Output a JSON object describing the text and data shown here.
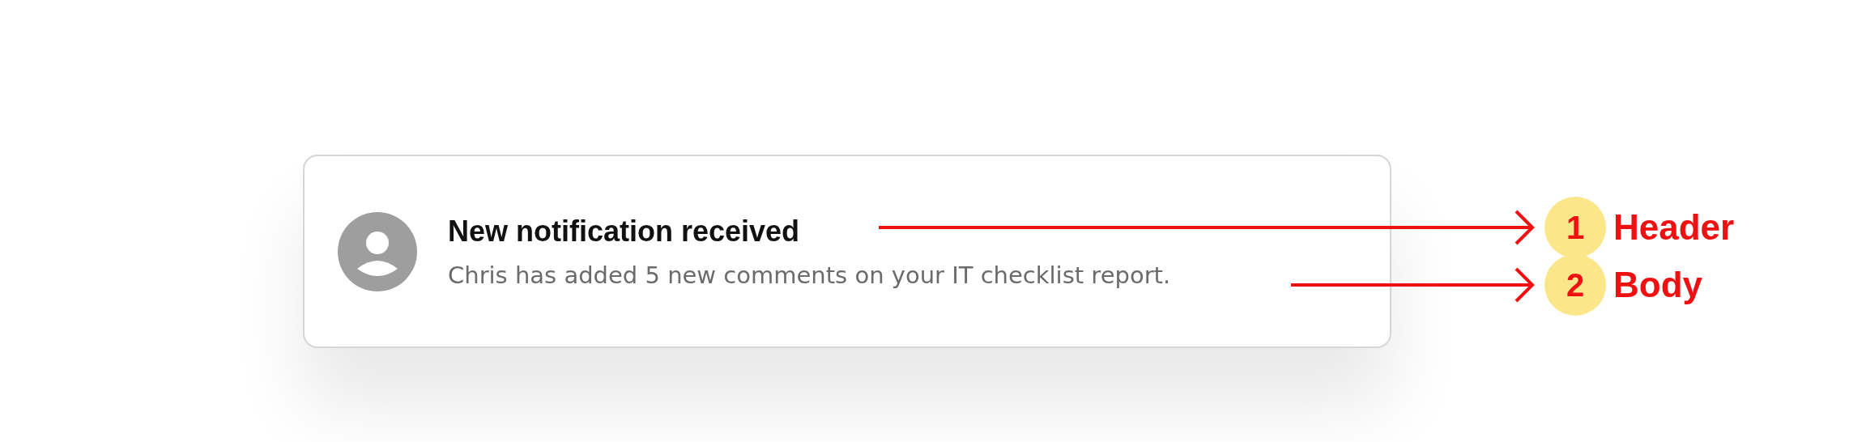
{
  "notification": {
    "title": "New notification received",
    "body": "Chris has added 5 new comments on your IT checklist report."
  },
  "annotations": [
    {
      "number": "1",
      "label": "Header"
    },
    {
      "number": "2",
      "label": "Body"
    }
  ]
}
